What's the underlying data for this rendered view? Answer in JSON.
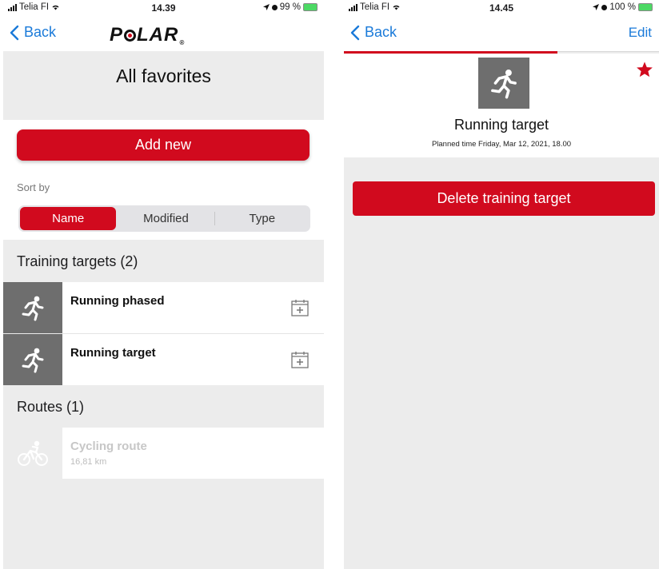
{
  "colors": {
    "accent": "#d10a1e",
    "link": "#1a7ad9",
    "thumb_bg": "#6e6e6e"
  },
  "left": {
    "status": {
      "carrier": "Telia FI",
      "time": "14.39",
      "battery": "99 %"
    },
    "nav": {
      "back_label": "Back",
      "logo_text_pre": "P",
      "logo_text_post": "LAR"
    },
    "title": "All favorites",
    "add_new_label": "Add new",
    "sort_by_label": "Sort by",
    "sort_options": [
      {
        "label": "Name",
        "selected": true
      },
      {
        "label": "Modified",
        "selected": false
      },
      {
        "label": "Type",
        "selected": false
      }
    ],
    "training_targets_header": "Training targets (2)",
    "training_targets": [
      {
        "title": "Running phased",
        "icon": "running-icon"
      },
      {
        "title": "Running target",
        "icon": "running-icon"
      }
    ],
    "routes_header": "Routes (1)",
    "routes": [
      {
        "title": "Cycling route",
        "subtitle": "16,81 km",
        "icon": "cycling-icon"
      }
    ]
  },
  "right": {
    "status": {
      "carrier": "Telia FI",
      "time": "14.45",
      "battery": "100 %"
    },
    "nav": {
      "back_label": "Back",
      "edit_label": "Edit"
    },
    "detail_title": "Running target",
    "planned_time": "Planned time Friday, Mar 12, 2021, 18.00",
    "delete_label": "Delete training target",
    "favorite": true
  }
}
